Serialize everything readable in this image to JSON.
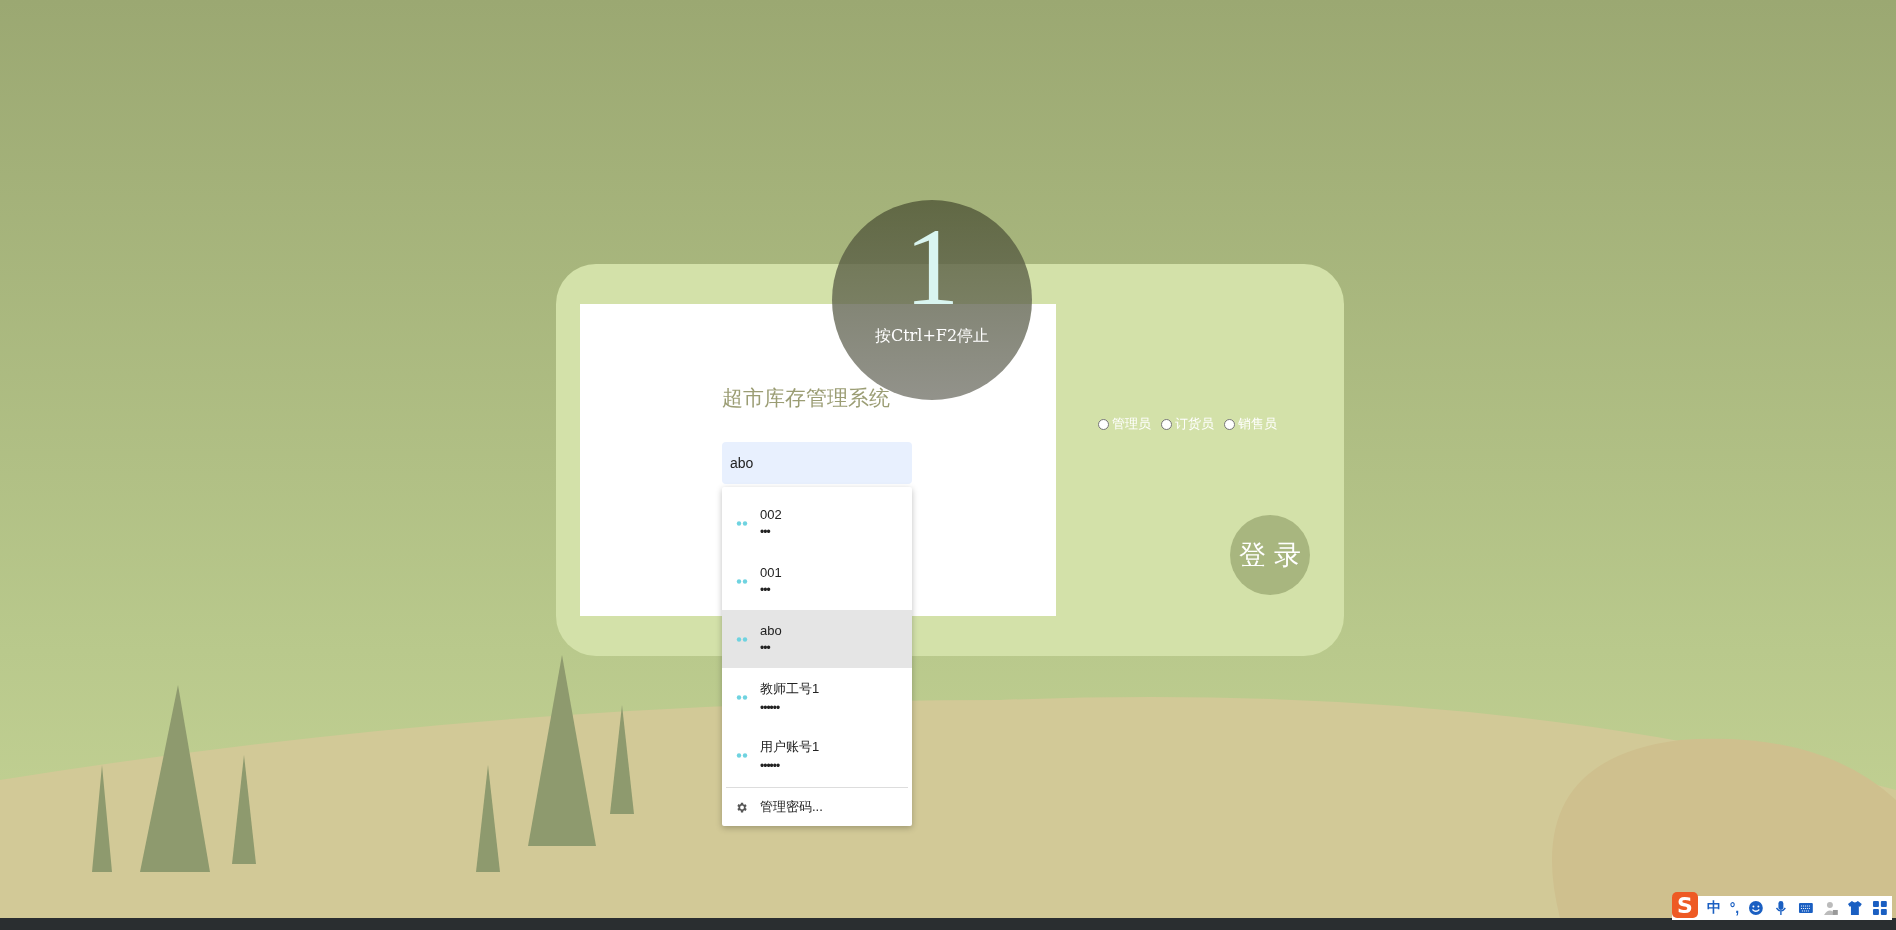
{
  "login": {
    "title": "超市库存管理系统",
    "username": {
      "value": "abo"
    },
    "roles": [
      {
        "label": "管理员",
        "selected": false
      },
      {
        "label": "订货员",
        "selected": false
      },
      {
        "label": "销售员",
        "selected": false
      }
    ],
    "submit": "登 录"
  },
  "autofill": {
    "items": [
      {
        "username": "002",
        "password": "•••",
        "selected": false
      },
      {
        "username": "001",
        "password": "•••",
        "selected": false
      },
      {
        "username": "abo",
        "password": "•••",
        "selected": true
      },
      {
        "username": "教师工号1",
        "password": "••••••",
        "selected": false
      },
      {
        "username": "用户账号1",
        "password": "••••••",
        "selected": false
      }
    ],
    "manage": "管理密码..."
  },
  "recorder": {
    "countdown": "1",
    "hint": "按Ctrl+F2停止"
  },
  "ime": {
    "logo": "S",
    "mode": "中",
    "punct": "°,"
  }
}
